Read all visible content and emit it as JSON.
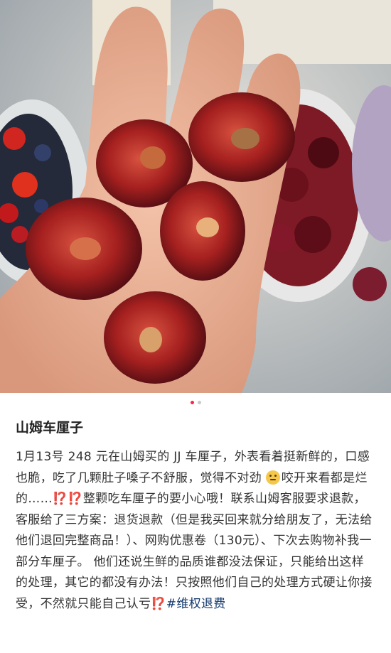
{
  "post": {
    "title": "山姆车厘子",
    "body_part1": "1月13号 248 元在山姆买的 JJ 车厘子，外表看着挺新鲜的，口感也脆，吃了几颗肚子嗓子不舒服，觉得不对劲",
    "emoji_name": "thinking-face-icon",
    "body_part2": "咬开来看都是烂的……",
    "alert_1": "⁉️⁉️",
    "body_part3": "整颗吃车厘子的要小心哦！联系山姆客服要求退款，客服给了三方案：退货退款（但是我买回来就分给朋友了，无法给他们退回完整商品！）、网购优惠卷（130元）、下次去购物补我一部分车厘子。 他们还说生鲜的品质谁都没法保证，只能给出这样的处理，其它的都没有办法！只按照他们自己的处理方式硬让你接受，不然就只能自己认亏",
    "alert_2": "⁉️",
    "hashtag": "#维权退费"
  },
  "carousel": {
    "total": 2,
    "active_index": 0
  },
  "colors": {
    "accent": "#ff2442",
    "hashtag": "#13386c",
    "alert": "#e63b2e"
  }
}
